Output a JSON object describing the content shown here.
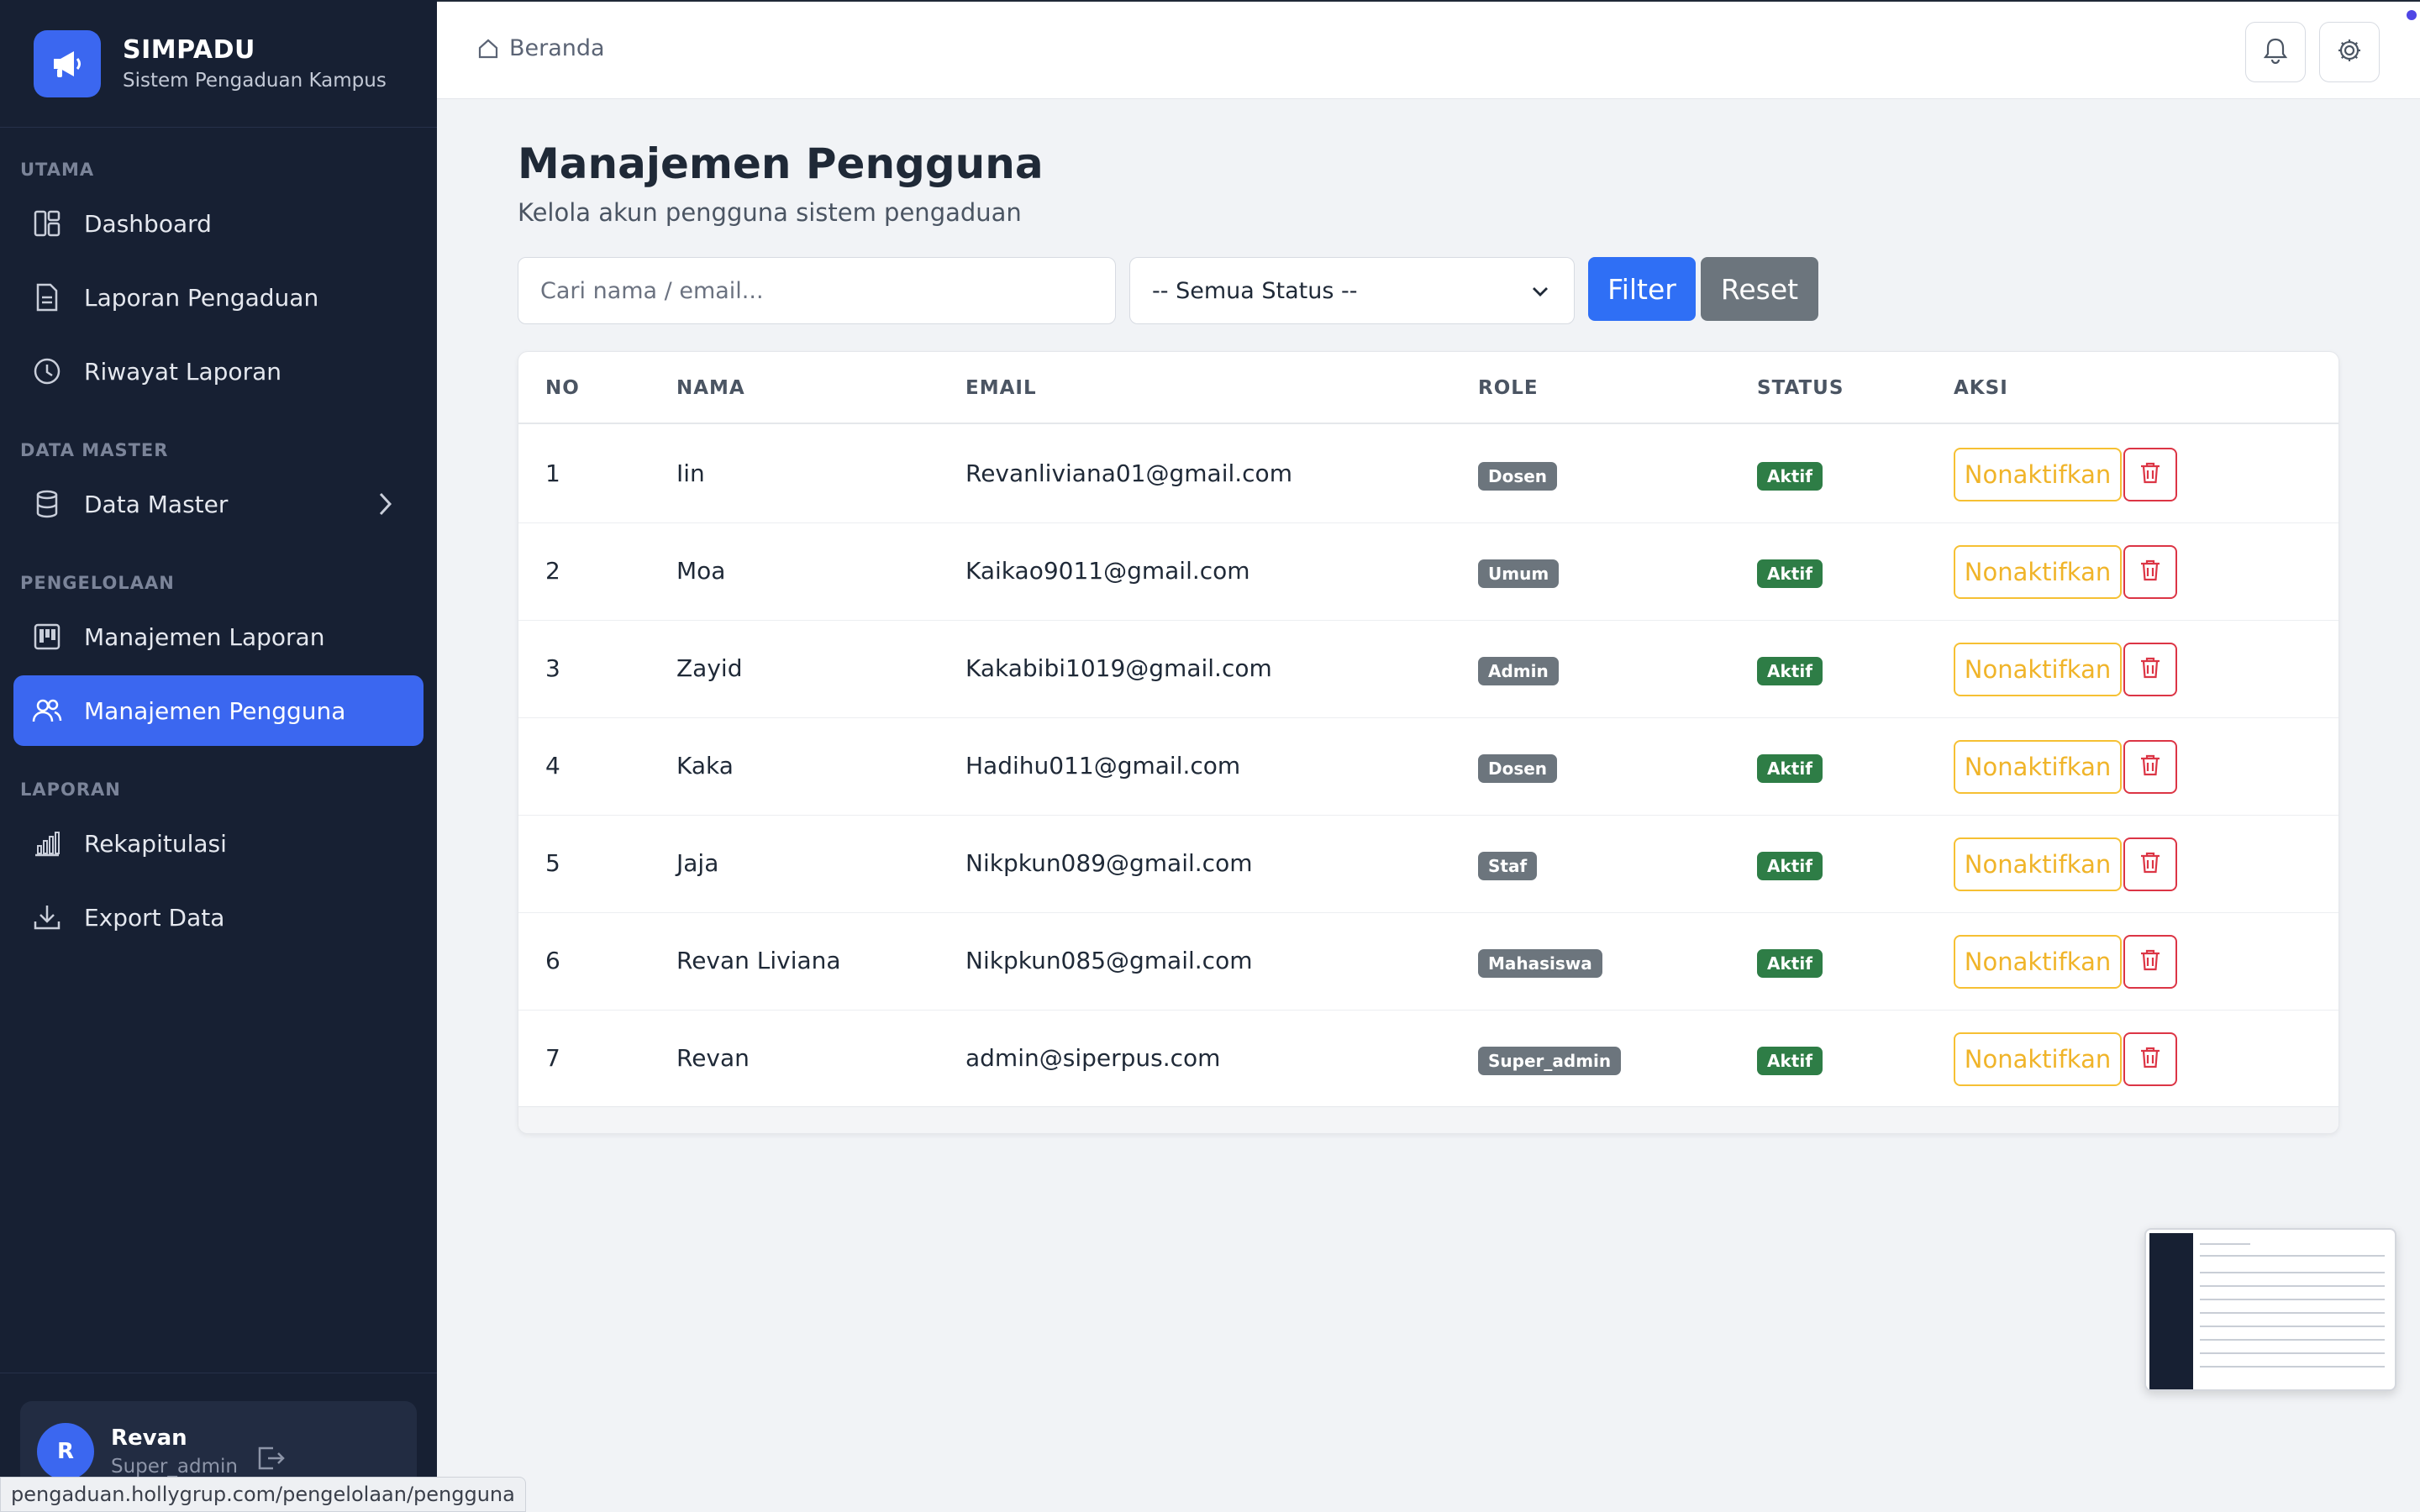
{
  "brand": {
    "title": "SIMPADU",
    "subtitle": "Sistem Pengaduan Kampus",
    "icon": "megaphone-icon"
  },
  "sidebar": {
    "sections": [
      {
        "label": "UTAMA"
      },
      {
        "label": "DATA MASTER"
      },
      {
        "label": "PENGELOLAAN"
      },
      {
        "label": "LAPORAN"
      }
    ],
    "items": [
      {
        "label": "Dashboard",
        "icon": "dashboard-icon"
      },
      {
        "label": "Laporan Pengaduan",
        "icon": "document-icon"
      },
      {
        "label": "Riwayat Laporan",
        "icon": "clock-icon"
      },
      {
        "label": "Data Master",
        "icon": "database-icon"
      },
      {
        "label": "Manajemen Laporan",
        "icon": "kanban-icon"
      },
      {
        "label": "Manajemen Pengguna",
        "icon": "users-icon",
        "active": true
      },
      {
        "label": "Rekapitulasi",
        "icon": "bar-chart-icon"
      },
      {
        "label": "Export Data",
        "icon": "download-icon"
      }
    ],
    "user": {
      "initial": "R",
      "name": "Revan",
      "role": "Super_admin"
    }
  },
  "topbar": {
    "breadcrumb": "Beranda"
  },
  "page": {
    "title": "Manajemen Pengguna",
    "subtitle": "Kelola akun pengguna sistem pengaduan"
  },
  "filters": {
    "search_placeholder": "Cari nama / email...",
    "status_selected": "-- Semua Status --",
    "filter_label": "Filter",
    "reset_label": "Reset"
  },
  "table": {
    "headers": [
      "NO",
      "NAMA",
      "EMAIL",
      "ROLE",
      "STATUS",
      "AKSI"
    ],
    "deactivate_label": "Nonaktifkan",
    "rows": [
      {
        "no": "1",
        "name": "Iin",
        "email": "Revanliviana01@gmail.com",
        "role": "Dosen",
        "status": "Aktif"
      },
      {
        "no": "2",
        "name": "Moa",
        "email": "Kaikao9011@gmail.com",
        "role": "Umum",
        "status": "Aktif"
      },
      {
        "no": "3",
        "name": "Zayid",
        "email": "Kakabibi1019@gmail.com",
        "role": "Admin",
        "status": "Aktif"
      },
      {
        "no": "4",
        "name": "Kaka",
        "email": "Hadihu011@gmail.com",
        "role": "Dosen",
        "status": "Aktif"
      },
      {
        "no": "5",
        "name": "Jaja",
        "email": "Nikpkun089@gmail.com",
        "role": "Staf",
        "status": "Aktif"
      },
      {
        "no": "6",
        "name": "Revan Liviana",
        "email": "Nikpkun085@gmail.com",
        "role": "Mahasiswa",
        "status": "Aktif"
      },
      {
        "no": "7",
        "name": "Revan",
        "email": "admin@siperpus.com",
        "role": "Super_admin",
        "status": "Aktif"
      }
    ]
  },
  "statusbar": {
    "url": "pengaduan.hollygrup.com/pengelolaan/pengguna"
  },
  "colors": {
    "sidebar_bg": "#172033",
    "accent": "#3b67f0",
    "filter_button": "#2f6ff5",
    "reset_button": "#6c757d",
    "status_active": "#2e7d46",
    "role_badge": "#6c757d",
    "warning": "#f0b429",
    "danger": "#dc3545"
  }
}
